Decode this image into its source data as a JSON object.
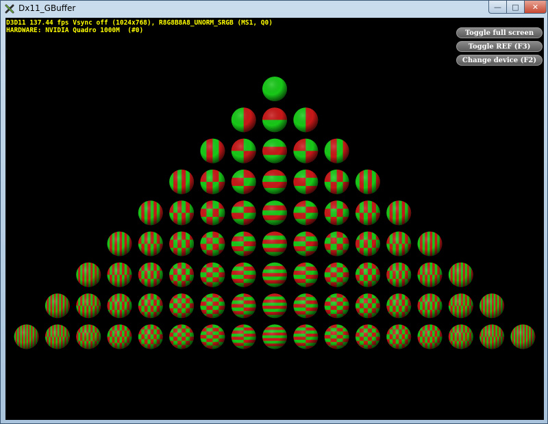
{
  "window": {
    "title": "Dx11_GBuffer",
    "controls": {
      "minimize": "—",
      "maximize": "□",
      "close": "✕"
    }
  },
  "stats": {
    "line1": "D3D11 137.44 fps Vsync off (1024x768), R8G8B8A8_UNORM_SRGB (MS1, Q0)",
    "line2": "HARDWARE: NVIDIA Quadro 1000M  (#0)"
  },
  "hud_buttons": [
    {
      "label": "Toggle full screen"
    },
    {
      "label": "Toggle REF (F3)"
    },
    {
      "label": "Change device (F2)"
    }
  ],
  "scene": {
    "description_type": "spherical harmonics pyramid",
    "rows": 9,
    "colors": {
      "positive": "#18c818",
      "negative": "#c81818",
      "background": "#000000"
    }
  }
}
